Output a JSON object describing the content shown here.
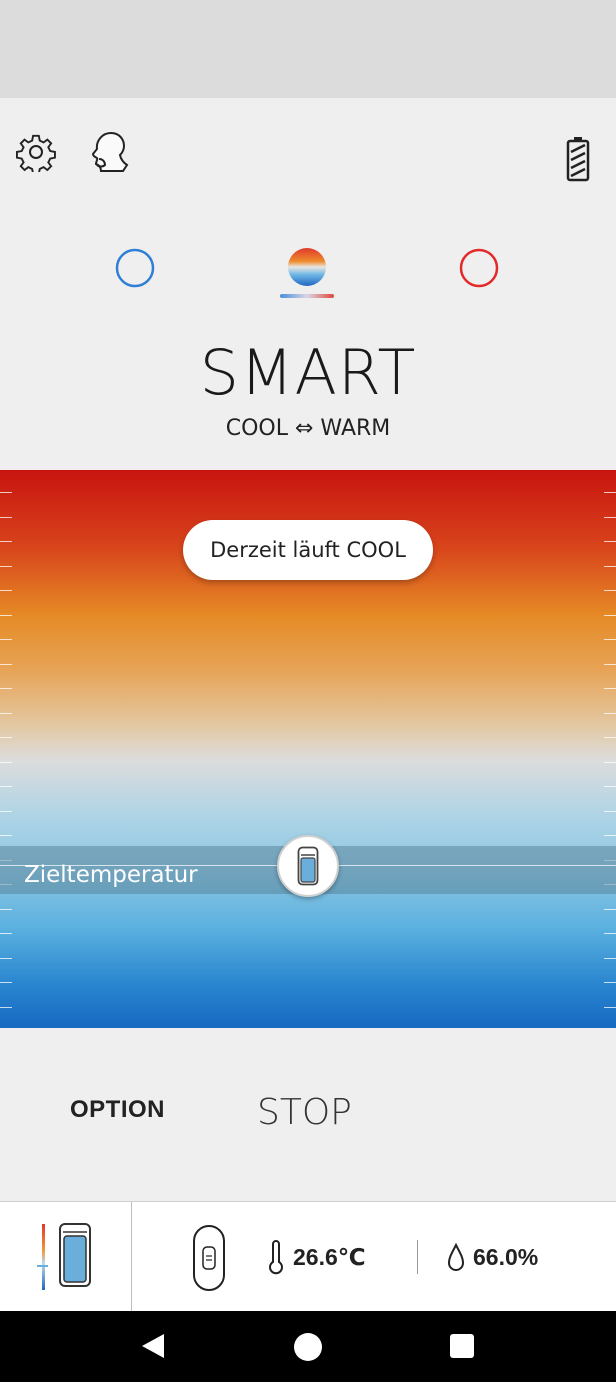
{
  "top_bar": {
    "settings_icon": "gear-icon",
    "profile_icon": "head-profile-icon",
    "battery_icon": "battery-icon"
  },
  "modes": {
    "items": [
      {
        "id": "cool",
        "icon": "cool-mode-circle-icon",
        "color": "#2f7fd6"
      },
      {
        "id": "smart",
        "icon": "smart-mode-gradient-icon",
        "color": "#e2473a",
        "selected": true
      },
      {
        "id": "warm",
        "icon": "warm-mode-circle-icon",
        "color": "#e22a2a"
      }
    ]
  },
  "mode": {
    "title": "SMART",
    "subtitle": "COOL ⇔ WARM"
  },
  "temperature_panel": {
    "status": "Derzeit läuft COOL",
    "target_label": "Zieltemperatur"
  },
  "actions": {
    "option": "OPTION",
    "stop": "STOP"
  },
  "info": {
    "temperature": "26.6℃",
    "humidity": "66.0%"
  },
  "colors": {
    "cool": "#2f7fd6",
    "warm": "#e22a2a",
    "gradient_top": "#c8140f",
    "gradient_bottom": "#1769c2"
  }
}
